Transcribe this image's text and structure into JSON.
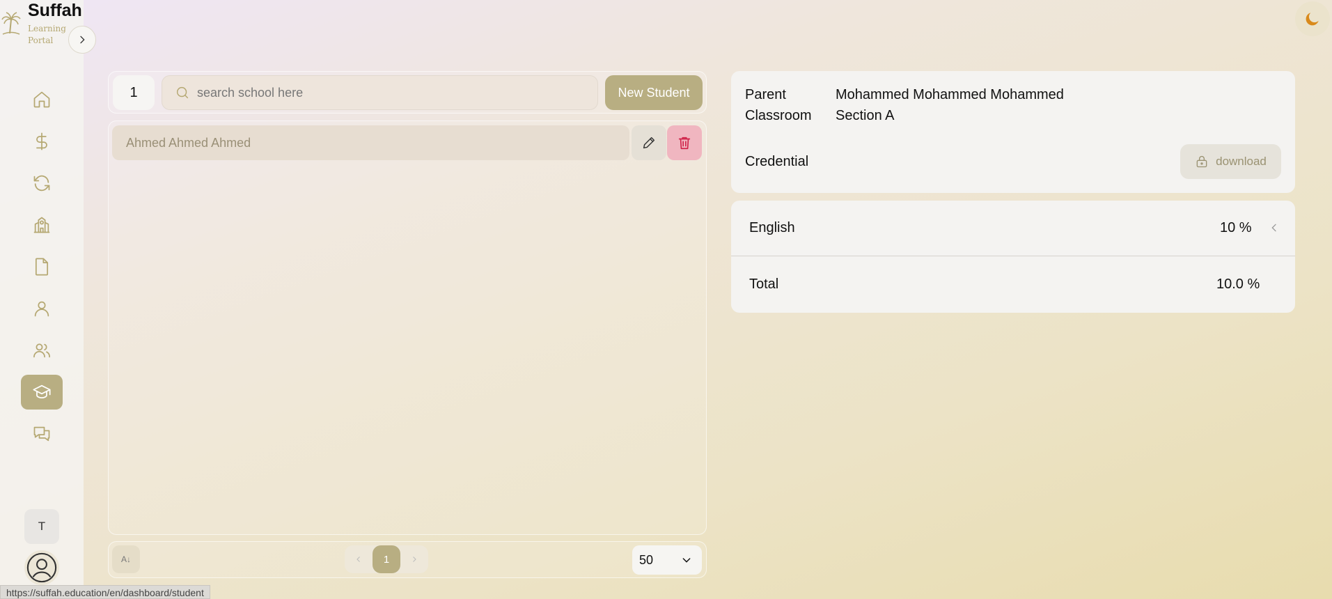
{
  "brand": {
    "name": "Suffah",
    "subtitle": "Learning Portal"
  },
  "sidebar": {
    "items": [
      {
        "icon": "home-icon",
        "active": false
      },
      {
        "icon": "dollar-icon",
        "active": false
      },
      {
        "icon": "refresh-icon",
        "active": false
      },
      {
        "icon": "school-icon",
        "active": false
      },
      {
        "icon": "document-icon",
        "active": false
      },
      {
        "icon": "user-icon",
        "active": false
      },
      {
        "icon": "users-icon",
        "active": false
      },
      {
        "icon": "graduation-cap-icon",
        "active": true
      },
      {
        "icon": "messages-icon",
        "active": false
      }
    ],
    "tenant_initial": "T"
  },
  "status_bar": {
    "url": "https://suffah.education/en/dashboard/student"
  },
  "toolbar": {
    "count": "1",
    "search_placeholder": "search school here",
    "new_button": "New Student"
  },
  "students": [
    {
      "name": "Ahmed Ahmed Ahmed"
    }
  ],
  "footer": {
    "sort_label": "A↓",
    "current_page": "1",
    "per_page": "50"
  },
  "details": {
    "parent_label": "Parent",
    "parent_value": "Mohammed Mohammed Mohammed",
    "classroom_label": "Classroom",
    "classroom_value": "Section A",
    "credential_label": "Credential",
    "download_label": "download"
  },
  "grades": [
    {
      "subject": "English",
      "value": "10 %"
    }
  ],
  "total": {
    "label": "Total",
    "value": "10.0 %"
  },
  "colors": {
    "accent": "#b8ae82",
    "danger": "#d0244a",
    "delete_bg": "#f0b6c0",
    "moon": "#d98a1c"
  }
}
